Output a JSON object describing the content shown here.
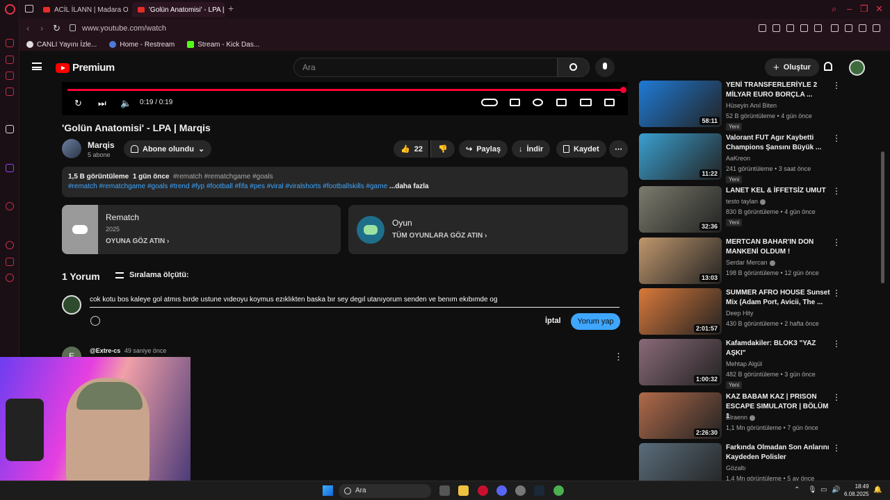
{
  "browser": {
    "tabs": [
      {
        "title": "ACİL İLANN | Madara Old"
      },
      {
        "title": "'Golün Anatomisi' - LPA |"
      }
    ],
    "url": "www.youtube.com/watch",
    "bookmarks": [
      "CANLI Yayını İzle...",
      "Home - Restream",
      "Stream - Kick Das..."
    ]
  },
  "yt_header": {
    "logo_text": "Premium",
    "search_placeholder": "Ara",
    "create_label": "Oluştur"
  },
  "player": {
    "time": "0:19 / 0:19",
    "progress": 1.0
  },
  "video": {
    "title": "'Golün Anatomisi' - LPA | Marqis",
    "channel": "Marqis",
    "subscribers": "5 abone",
    "subscribe_label": "Abone olundu",
    "likes": "22",
    "share_label": "Paylaş",
    "download_label": "İndir",
    "save_label": "Kaydet"
  },
  "description": {
    "views": "1,5 B görüntüleme",
    "date": "1 gün önce",
    "tags_line1": "#rematch #rematchgame #goals",
    "tags_line2": "#rematch #rematchgame #goals #trend #fyp #football #fifa #pes #viral #viralshorts #footballskills #game",
    "more": "...daha fazla"
  },
  "cards": {
    "game_title": "Rematch",
    "game_year": "2025",
    "game_link": "OYUNA GÖZ ATIN",
    "games_title": "Oyun",
    "games_link": "TÜM OYUNLARA GÖZ ATIN"
  },
  "comments": {
    "count_label": "1 Yorum",
    "sort_label": "Sıralama ölçütü:",
    "draft": "cok kotu bos kaleye gol atmıs bırde ustune vıdeoyu koymus ezıklıkten baska bır sey degıl utanıyorum senden ve benım ekıbımde og",
    "cancel_label": "İptal",
    "post_label": "Yorum yap",
    "first_avatar": "E",
    "first_user": "@Extre-cs",
    "first_time": "49 saniye önce"
  },
  "recommendations": [
    {
      "title": "YENİ TRANSFERLERİYLE 2 MİLYAR EURO BORÇLA ...",
      "channel": "Hüseyin Anıl Biten",
      "meta": "52 B görüntüleme • 4 gün önce",
      "badge": "Yeni",
      "duration": "58:11",
      "color": "#1f7bd6",
      "verified": false
    },
    {
      "title": "Valorant FUT Agır Kaybetti Champions Şansını Büyük ...",
      "channel": "AaKreon",
      "meta": "241 görüntüleme • 3 saat önce",
      "badge": "Yeni",
      "duration": "11:22",
      "color": "#3aa0d0",
      "verified": false
    },
    {
      "title": "LANET KEL & İFFETSİZ UMUT",
      "channel": "testo taylan",
      "meta": "830 B görüntüleme • 4 gün önce",
      "badge": "Yeni",
      "duration": "32:36",
      "color": "#7b7b6d",
      "verified": true
    },
    {
      "title": "MERTCAN BAHAR'IN DON MANKENİ OLDUM !",
      "channel": "Serdar Mercan",
      "meta": "198 B görüntüleme • 12 gün önce",
      "badge": "",
      "duration": "13:03",
      "color": "#c0976d",
      "verified": true
    },
    {
      "title": "SUMMER AFRO HOUSE Sunset Mix (Adam Port, Avicii, The ...",
      "channel": "Deep Hity",
      "meta": "430 B görüntüleme • 2 hafta önce",
      "badge": "",
      "duration": "2:01:57",
      "color": "#d9793a",
      "verified": false
    },
    {
      "title": "Kafamdakiler: BLOK3 \"YAZ AŞKI\"",
      "channel": "Mehtap Algül",
      "meta": "482 B görüntüleme • 3 gün önce",
      "badge": "Yeni",
      "duration": "1:00:32",
      "color": "#8a6a78",
      "verified": false
    },
    {
      "title": "KAZ BABAM KAZ | PRISON ESCAPE SIMULATOR | BÖLÜM 1",
      "channel": "Elraenn",
      "meta": "1,1 Mn görüntüleme • 7 gün önce",
      "badge": "",
      "duration": "2:26:30",
      "color": "#b06a4a",
      "verified": true
    },
    {
      "title": "Farkında Olmadan Son Anlarını Kaydeden Polisler",
      "channel": "Gözaltı",
      "meta": "1,4 Mn görüntüleme • 5 ay önce",
      "badge": "",
      "duration": "",
      "color": "#5a6d7b",
      "verified": false
    }
  ],
  "taskbar": {
    "search_label": "Ara",
    "time": "18:49",
    "date": "6.08.2025"
  }
}
